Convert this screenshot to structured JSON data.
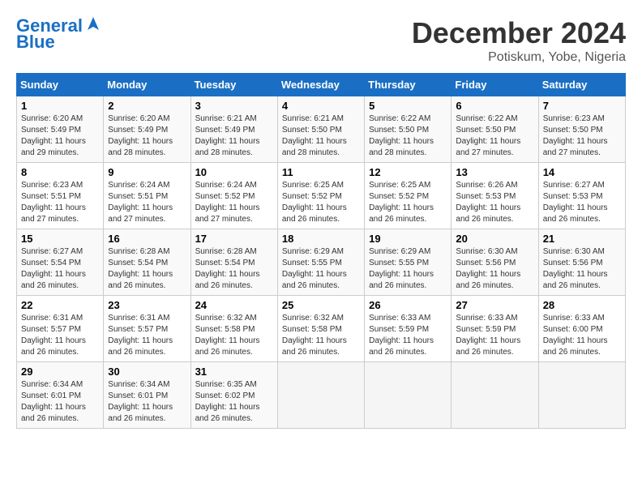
{
  "header": {
    "logo_line1": "General",
    "logo_line2": "Blue",
    "month": "December 2024",
    "location": "Potiskum, Yobe, Nigeria"
  },
  "days_of_week": [
    "Sunday",
    "Monday",
    "Tuesday",
    "Wednesday",
    "Thursday",
    "Friday",
    "Saturday"
  ],
  "weeks": [
    [
      {
        "day": "1",
        "info": "Sunrise: 6:20 AM\nSunset: 5:49 PM\nDaylight: 11 hours\nand 29 minutes."
      },
      {
        "day": "2",
        "info": "Sunrise: 6:20 AM\nSunset: 5:49 PM\nDaylight: 11 hours\nand 28 minutes."
      },
      {
        "day": "3",
        "info": "Sunrise: 6:21 AM\nSunset: 5:49 PM\nDaylight: 11 hours\nand 28 minutes."
      },
      {
        "day": "4",
        "info": "Sunrise: 6:21 AM\nSunset: 5:50 PM\nDaylight: 11 hours\nand 28 minutes."
      },
      {
        "day": "5",
        "info": "Sunrise: 6:22 AM\nSunset: 5:50 PM\nDaylight: 11 hours\nand 28 minutes."
      },
      {
        "day": "6",
        "info": "Sunrise: 6:22 AM\nSunset: 5:50 PM\nDaylight: 11 hours\nand 27 minutes."
      },
      {
        "day": "7",
        "info": "Sunrise: 6:23 AM\nSunset: 5:50 PM\nDaylight: 11 hours\nand 27 minutes."
      }
    ],
    [
      {
        "day": "8",
        "info": "Sunrise: 6:23 AM\nSunset: 5:51 PM\nDaylight: 11 hours\nand 27 minutes."
      },
      {
        "day": "9",
        "info": "Sunrise: 6:24 AM\nSunset: 5:51 PM\nDaylight: 11 hours\nand 27 minutes."
      },
      {
        "day": "10",
        "info": "Sunrise: 6:24 AM\nSunset: 5:52 PM\nDaylight: 11 hours\nand 27 minutes."
      },
      {
        "day": "11",
        "info": "Sunrise: 6:25 AM\nSunset: 5:52 PM\nDaylight: 11 hours\nand 26 minutes."
      },
      {
        "day": "12",
        "info": "Sunrise: 6:25 AM\nSunset: 5:52 PM\nDaylight: 11 hours\nand 26 minutes."
      },
      {
        "day": "13",
        "info": "Sunrise: 6:26 AM\nSunset: 5:53 PM\nDaylight: 11 hours\nand 26 minutes."
      },
      {
        "day": "14",
        "info": "Sunrise: 6:27 AM\nSunset: 5:53 PM\nDaylight: 11 hours\nand 26 minutes."
      }
    ],
    [
      {
        "day": "15",
        "info": "Sunrise: 6:27 AM\nSunset: 5:54 PM\nDaylight: 11 hours\nand 26 minutes."
      },
      {
        "day": "16",
        "info": "Sunrise: 6:28 AM\nSunset: 5:54 PM\nDaylight: 11 hours\nand 26 minutes."
      },
      {
        "day": "17",
        "info": "Sunrise: 6:28 AM\nSunset: 5:54 PM\nDaylight: 11 hours\nand 26 minutes."
      },
      {
        "day": "18",
        "info": "Sunrise: 6:29 AM\nSunset: 5:55 PM\nDaylight: 11 hours\nand 26 minutes."
      },
      {
        "day": "19",
        "info": "Sunrise: 6:29 AM\nSunset: 5:55 PM\nDaylight: 11 hours\nand 26 minutes."
      },
      {
        "day": "20",
        "info": "Sunrise: 6:30 AM\nSunset: 5:56 PM\nDaylight: 11 hours\nand 26 minutes."
      },
      {
        "day": "21",
        "info": "Sunrise: 6:30 AM\nSunset: 5:56 PM\nDaylight: 11 hours\nand 26 minutes."
      }
    ],
    [
      {
        "day": "22",
        "info": "Sunrise: 6:31 AM\nSunset: 5:57 PM\nDaylight: 11 hours\nand 26 minutes."
      },
      {
        "day": "23",
        "info": "Sunrise: 6:31 AM\nSunset: 5:57 PM\nDaylight: 11 hours\nand 26 minutes."
      },
      {
        "day": "24",
        "info": "Sunrise: 6:32 AM\nSunset: 5:58 PM\nDaylight: 11 hours\nand 26 minutes."
      },
      {
        "day": "25",
        "info": "Sunrise: 6:32 AM\nSunset: 5:58 PM\nDaylight: 11 hours\nand 26 minutes."
      },
      {
        "day": "26",
        "info": "Sunrise: 6:33 AM\nSunset: 5:59 PM\nDaylight: 11 hours\nand 26 minutes."
      },
      {
        "day": "27",
        "info": "Sunrise: 6:33 AM\nSunset: 5:59 PM\nDaylight: 11 hours\nand 26 minutes."
      },
      {
        "day": "28",
        "info": "Sunrise: 6:33 AM\nSunset: 6:00 PM\nDaylight: 11 hours\nand 26 minutes."
      }
    ],
    [
      {
        "day": "29",
        "info": "Sunrise: 6:34 AM\nSunset: 6:01 PM\nDaylight: 11 hours\nand 26 minutes."
      },
      {
        "day": "30",
        "info": "Sunrise: 6:34 AM\nSunset: 6:01 PM\nDaylight: 11 hours\nand 26 minutes."
      },
      {
        "day": "31",
        "info": "Sunrise: 6:35 AM\nSunset: 6:02 PM\nDaylight: 11 hours\nand 26 minutes."
      },
      {
        "day": "",
        "info": ""
      },
      {
        "day": "",
        "info": ""
      },
      {
        "day": "",
        "info": ""
      },
      {
        "day": "",
        "info": ""
      }
    ]
  ]
}
